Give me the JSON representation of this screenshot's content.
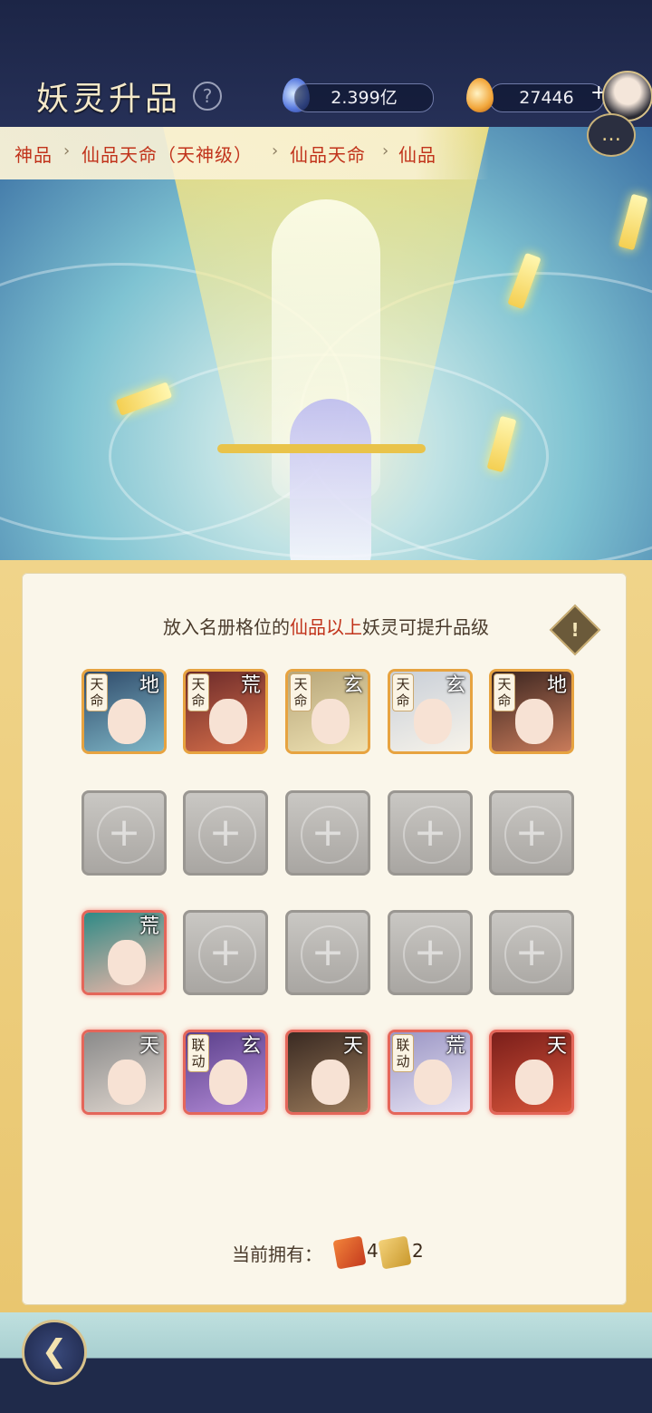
{
  "header": {
    "title": "妖灵升品",
    "help_label": "?",
    "resource1": {
      "value": "2.399亿",
      "icon": "blue-spirit-flame-icon"
    },
    "resource2": {
      "value": "27446",
      "icon": "gold-flame-icon"
    },
    "add_label": "+"
  },
  "breadcrumb": [
    "神品",
    "仙品天命（天神级）",
    "仙品天命",
    "仙品"
  ],
  "breadcrumb_sep": "›",
  "panel": {
    "instruction_pre": "放入名册格位的",
    "instruction_highlight": "仙品以上",
    "instruction_post": "妖灵可提升品级",
    "warn_label": "!",
    "slots": [
      [
        {
          "filled": true,
          "badge": "天命",
          "grade": "地",
          "palette": [
            "#2f4a6a",
            "#7fb7c7"
          ]
        },
        {
          "filled": true,
          "badge": "天命",
          "grade": "荒",
          "palette": [
            "#6b2a2a",
            "#d8704a"
          ]
        },
        {
          "filled": true,
          "badge": "天命",
          "grade": "玄",
          "palette": [
            "#b7a67a",
            "#efe2b3"
          ]
        },
        {
          "filled": true,
          "badge": "天命",
          "grade": "玄",
          "palette": [
            "#c9cfd8",
            "#f7f3ea"
          ]
        },
        {
          "filled": true,
          "badge": "天命",
          "grade": "地",
          "palette": [
            "#3a2520",
            "#c97b5a"
          ]
        }
      ],
      [
        {
          "filled": false
        },
        {
          "filled": false
        },
        {
          "filled": false
        },
        {
          "filled": false
        },
        {
          "filled": false
        }
      ],
      [
        {
          "filled": true,
          "red": true,
          "badge": "",
          "grade": "荒",
          "palette": [
            "#2f8a86",
            "#f3b7a8"
          ]
        },
        {
          "filled": false
        },
        {
          "filled": false
        },
        {
          "filled": false
        },
        {
          "filled": false
        }
      ],
      [
        {
          "filled": true,
          "red": true,
          "badge": "",
          "grade": "天",
          "palette": [
            "#8a8a8a",
            "#e0d7cf"
          ]
        },
        {
          "filled": true,
          "red": true,
          "badge": "联动",
          "grade": "玄",
          "palette": [
            "#5a3f8a",
            "#b28ad6"
          ]
        },
        {
          "filled": true,
          "red": true,
          "badge": "",
          "grade": "天",
          "palette": [
            "#3a2a22",
            "#9a7a5a"
          ]
        },
        {
          "filled": true,
          "red": true,
          "badge": "联动",
          "grade": "荒",
          "palette": [
            "#9a95c4",
            "#e8e4f4"
          ]
        },
        {
          "filled": true,
          "red": true,
          "badge": "",
          "grade": "天",
          "palette": [
            "#7a1e1a",
            "#d8553a"
          ]
        }
      ]
    ],
    "owned_label": "当前拥有：",
    "owned": [
      {
        "icon": "red-scroll-ticket-icon",
        "value": "4"
      },
      {
        "icon": "gold-scroll-ticket-icon",
        "value": "2"
      }
    ]
  },
  "nav": {
    "back_label": "❮",
    "back_icon": "back-arrow-icon"
  }
}
